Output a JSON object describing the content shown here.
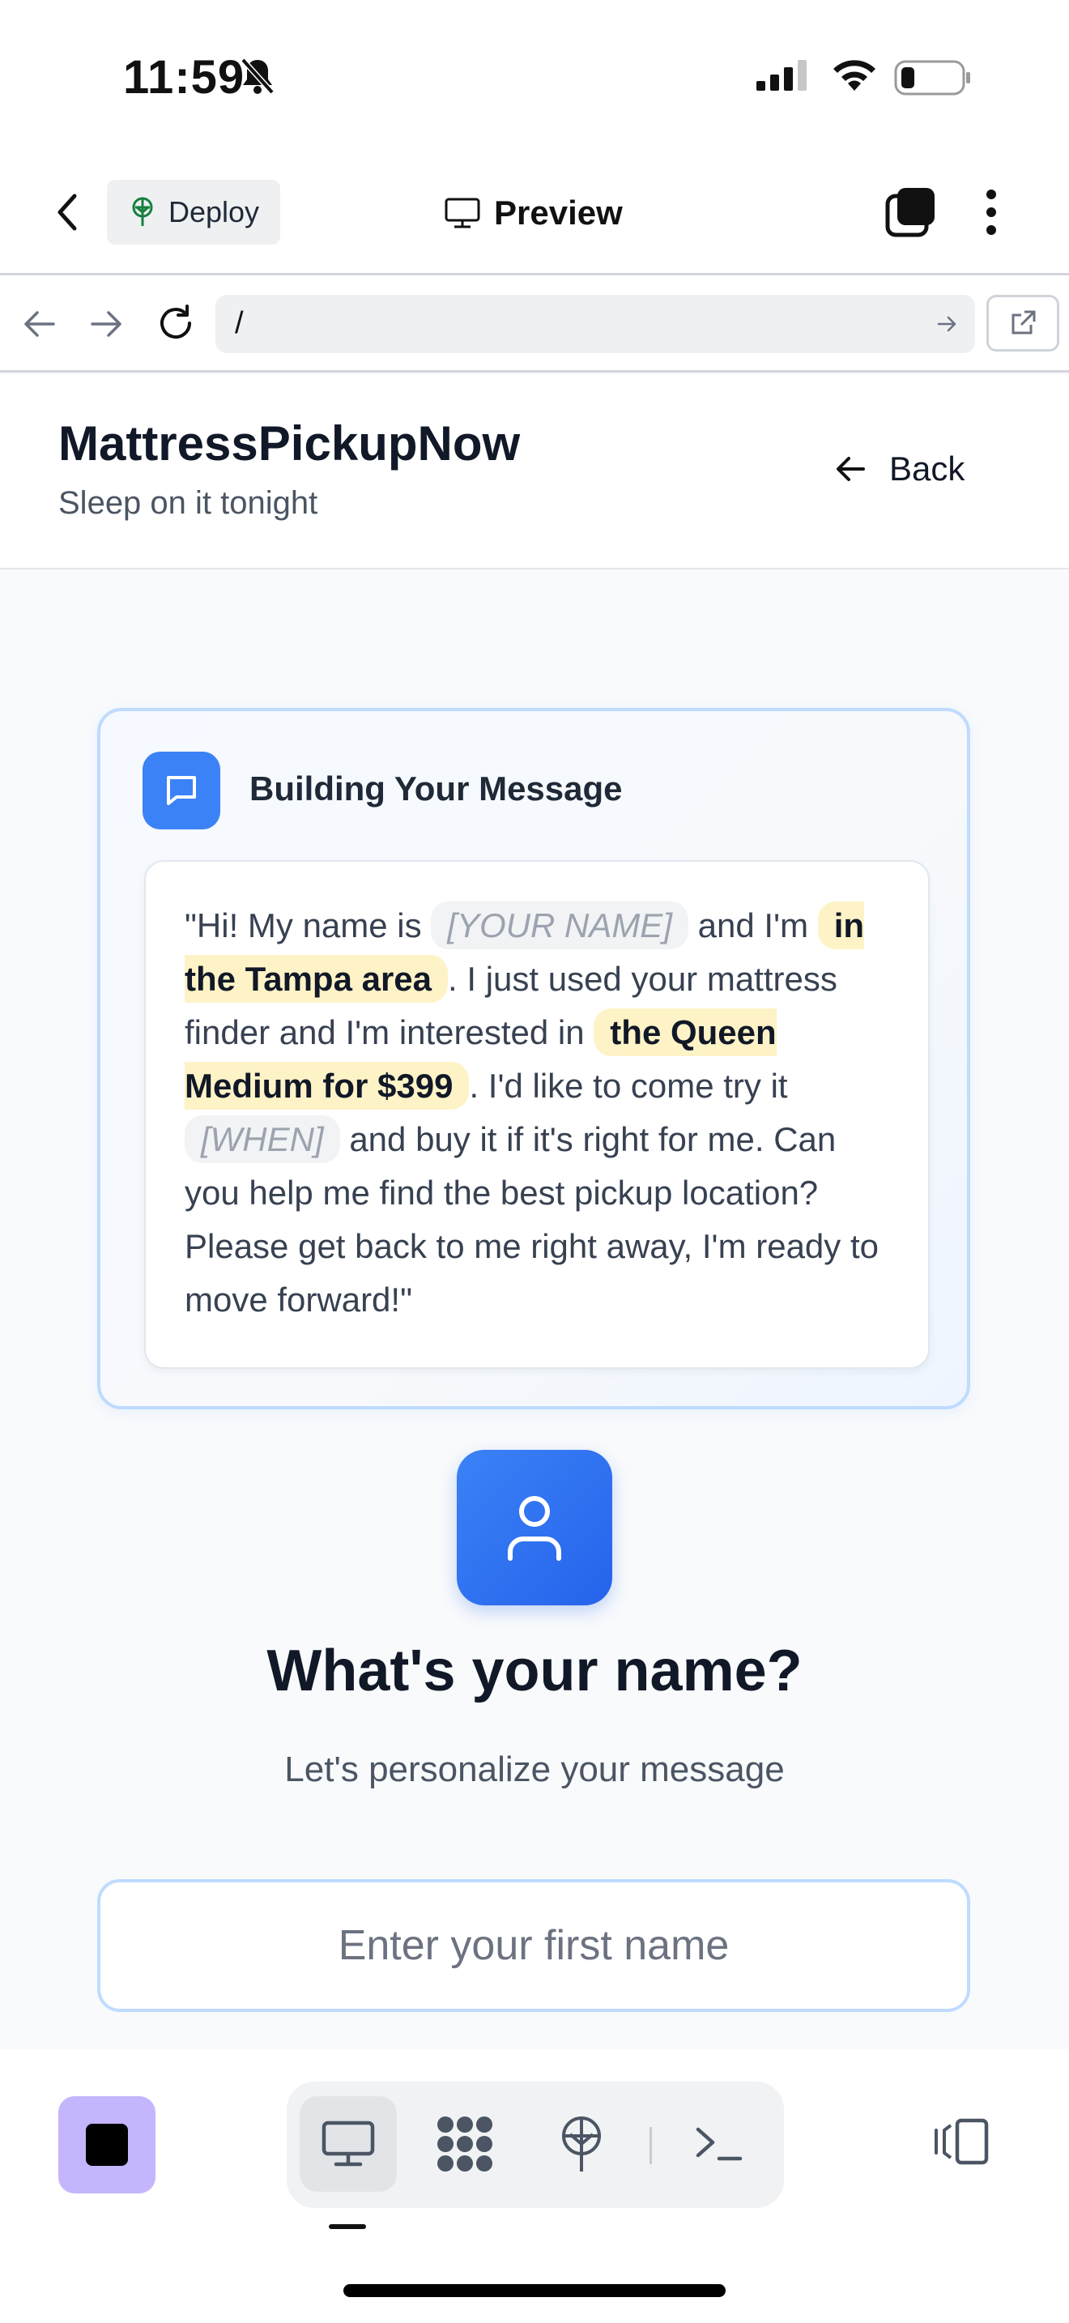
{
  "status_bar": {
    "time": "11:59"
  },
  "app_bar": {
    "deploy_label": "Deploy",
    "preview_label": "Preview"
  },
  "url_bar": {
    "path": "/"
  },
  "site": {
    "brand": "MattressPickupNow",
    "tagline": "Sleep on it tonight",
    "back_label": "Back"
  },
  "message_card": {
    "title": "Building Your Message",
    "segments": [
      {
        "t": "\"Hi! My name is ",
        "kind": "text"
      },
      {
        "t": "[YOUR NAME]",
        "kind": "placeholder"
      },
      {
        "t": " and I'm ",
        "kind": "text"
      },
      {
        "t": "in the Tampa area",
        "kind": "highlight"
      },
      {
        "t": ". I just used your mattress finder and I'm interested in ",
        "kind": "text"
      },
      {
        "t": "the Queen Medium for $399",
        "kind": "highlight"
      },
      {
        "t": ". I'd like to come try it ",
        "kind": "text"
      },
      {
        "t": "[WHEN]",
        "kind": "placeholder"
      },
      {
        "t": " and buy it if it's right for me. Can you help me find the best pickup location? Please get back to me right away, I'm ready to move forward!\"",
        "kind": "text"
      }
    ]
  },
  "name_step": {
    "question": "What's your name?",
    "subtitle": "Let's personalize your message",
    "input_placeholder": "Enter your first name",
    "input_value": ""
  },
  "colors": {
    "accent": "#3b82f6",
    "highlight_bg": "#fef3c7",
    "placeholder_bg": "#f1f3f5",
    "card_border": "#bfdbfe",
    "purple_button": "#c4b5fd"
  },
  "bottom_toolbar": {
    "tabs": [
      "monitor-icon",
      "apps-icon",
      "deploy-icon",
      "terminal-icon"
    ],
    "active_tab": "monitor-icon"
  }
}
